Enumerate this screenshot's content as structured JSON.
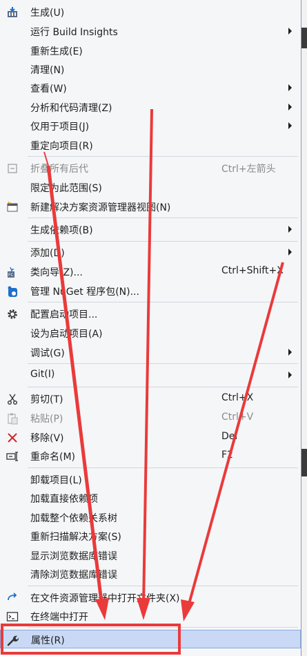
{
  "menu": {
    "items": [
      {
        "label": "生成(U)",
        "shortcut": "",
        "submenu": false,
        "disabled": false,
        "icon": "build-icon"
      },
      {
        "label": "运行 Build Insights",
        "shortcut": "",
        "submenu": true,
        "disabled": false,
        "icon": ""
      },
      {
        "label": "重新生成(E)",
        "shortcut": "",
        "submenu": false,
        "disabled": false,
        "icon": ""
      },
      {
        "label": "清理(N)",
        "shortcut": "",
        "submenu": false,
        "disabled": false,
        "icon": ""
      },
      {
        "label": "查看(W)",
        "shortcut": "",
        "submenu": true,
        "disabled": false,
        "icon": ""
      },
      {
        "label": "分析和代码清理(Z)",
        "shortcut": "",
        "submenu": true,
        "disabled": false,
        "icon": ""
      },
      {
        "label": "仅用于项目(J)",
        "shortcut": "",
        "submenu": true,
        "disabled": false,
        "icon": ""
      },
      {
        "label": "重定向项目(R)",
        "shortcut": "",
        "submenu": false,
        "disabled": false,
        "icon": ""
      },
      {
        "label": "折叠所有后代",
        "shortcut": "Ctrl+左箭头",
        "submenu": false,
        "disabled": true,
        "icon": "collapse-icon"
      },
      {
        "label": "限定为此范围(S)",
        "shortcut": "",
        "submenu": false,
        "disabled": false,
        "icon": ""
      },
      {
        "label": "新建解决方案资源管理器视图(N)",
        "shortcut": "",
        "submenu": false,
        "disabled": false,
        "icon": "new-view-icon"
      },
      {
        "label": "生成依赖项(B)",
        "shortcut": "",
        "submenu": true,
        "disabled": false,
        "icon": ""
      },
      {
        "label": "添加(D)",
        "shortcut": "",
        "submenu": true,
        "disabled": false,
        "icon": ""
      },
      {
        "label": "类向导(Z)...",
        "shortcut": "Ctrl+Shift+X",
        "submenu": false,
        "disabled": false,
        "icon": "class-wizard-icon"
      },
      {
        "label": "管理 NuGet 程序包(N)...",
        "shortcut": "",
        "submenu": false,
        "disabled": false,
        "icon": "nuget-icon"
      },
      {
        "label": "配置启动项目...",
        "shortcut": "",
        "submenu": false,
        "disabled": false,
        "icon": "gear-icon"
      },
      {
        "label": "设为启动项目(A)",
        "shortcut": "",
        "submenu": false,
        "disabled": false,
        "icon": ""
      },
      {
        "label": "调试(G)",
        "shortcut": "",
        "submenu": true,
        "disabled": false,
        "icon": ""
      },
      {
        "label": "Git(I)",
        "shortcut": "",
        "submenu": true,
        "disabled": false,
        "icon": ""
      },
      {
        "label": "剪切(T)",
        "shortcut": "Ctrl+X",
        "submenu": false,
        "disabled": false,
        "icon": "scissors-icon"
      },
      {
        "label": "粘贴(P)",
        "shortcut": "Ctrl+V",
        "submenu": false,
        "disabled": true,
        "icon": "paste-icon"
      },
      {
        "label": "移除(V)",
        "shortcut": "Del",
        "submenu": false,
        "disabled": false,
        "icon": "remove-icon"
      },
      {
        "label": "重命名(M)",
        "shortcut": "F2",
        "submenu": false,
        "disabled": false,
        "icon": "rename-icon"
      },
      {
        "label": "卸载项目(L)",
        "shortcut": "",
        "submenu": false,
        "disabled": false,
        "icon": ""
      },
      {
        "label": "加载直接依赖项",
        "shortcut": "",
        "submenu": false,
        "disabled": false,
        "icon": ""
      },
      {
        "label": "加载整个依赖关系树",
        "shortcut": "",
        "submenu": false,
        "disabled": false,
        "icon": ""
      },
      {
        "label": "重新扫描解决方案(S)",
        "shortcut": "",
        "submenu": false,
        "disabled": false,
        "icon": ""
      },
      {
        "label": "显示浏览数据库错误",
        "shortcut": "",
        "submenu": false,
        "disabled": false,
        "icon": ""
      },
      {
        "label": "清除浏览数据库错误",
        "shortcut": "",
        "submenu": false,
        "disabled": false,
        "icon": ""
      },
      {
        "label": "在文件资源管理器中打开文件夹(X)",
        "shortcut": "",
        "submenu": false,
        "disabled": false,
        "icon": "open-folder-icon"
      },
      {
        "label": "在终端中打开",
        "shortcut": "",
        "submenu": false,
        "disabled": false,
        "icon": "terminal-icon"
      },
      {
        "label": "属性(R)",
        "shortcut": "",
        "submenu": false,
        "disabled": false,
        "icon": "wrench-icon",
        "selected": true
      }
    ]
  },
  "colors": {
    "annotation": "#ea3a3a",
    "selection": "#c9d9f5"
  }
}
